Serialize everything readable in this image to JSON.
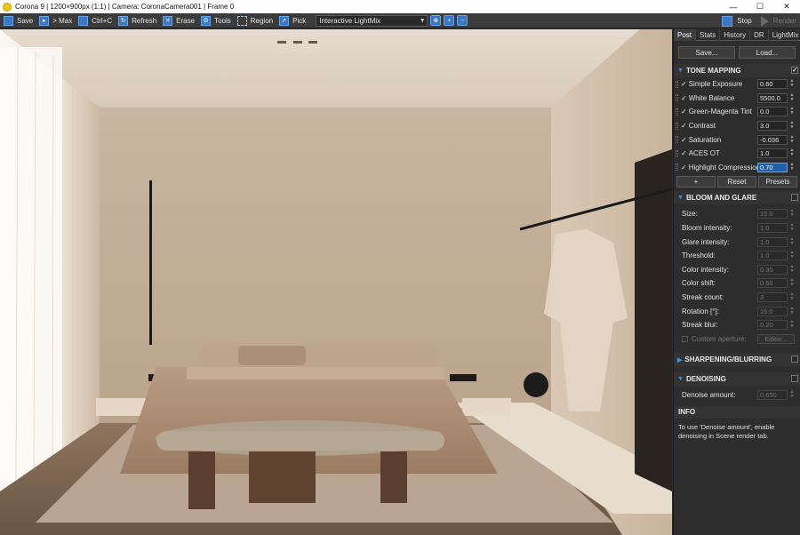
{
  "titlebar": {
    "title": "Corona 9 | 1200×900px (1:1) | Camera: CoronaCamera001 | Frame 0",
    "minimize": "—",
    "maximize": "☐",
    "close": "✕"
  },
  "toolbar": {
    "save": "Save",
    "max": "> Max",
    "copy": "Ctrl+C",
    "refresh": "Refresh",
    "erase": "Erase",
    "tools": "Tools",
    "region": "Region",
    "pick": "Pick",
    "mode": "Interactive LightMix",
    "stop": "Stop",
    "render": "Render"
  },
  "panel": {
    "tabs": [
      "Post",
      "Stats",
      "History",
      "DR",
      "LightMix"
    ],
    "save_btn": "Save...",
    "load_btn": "Load...",
    "tone_mapping": {
      "title": "TONE MAPPING",
      "enabled_mark": "✓",
      "rows": [
        {
          "label": "Simple Exposure",
          "value": "0.60"
        },
        {
          "label": "White Balance",
          "value": "5500.0"
        },
        {
          "label": "Green-Magenta Tint",
          "value": "0.0"
        },
        {
          "label": "Contrast",
          "value": "3.0"
        },
        {
          "label": "Saturation",
          "value": "-0.036"
        },
        {
          "label": "ACES OT",
          "value": "1.0"
        },
        {
          "label": "Highlight Compression",
          "value": "0.70"
        }
      ],
      "add_btn": "+",
      "reset_btn": "Reset",
      "presets_btn": "Presets"
    },
    "bloom": {
      "title": "BLOOM AND GLARE",
      "rows": [
        {
          "label": "Size:",
          "value": "15.0"
        },
        {
          "label": "Bloom intensity:",
          "value": "1.0"
        },
        {
          "label": "Glare intensity:",
          "value": "1.0"
        },
        {
          "label": "Threshold:",
          "value": "1.0"
        },
        {
          "label": "Color intensity:",
          "value": "0.30"
        },
        {
          "label": "Color shift:",
          "value": "0.50"
        },
        {
          "label": "Streak count:",
          "value": "3"
        },
        {
          "label": "Rotation [°]:",
          "value": "15.0"
        },
        {
          "label": "Streak blur:",
          "value": "0.20"
        }
      ],
      "custom_aperture": "Custom aperture:",
      "editor_btn": "Editor..."
    },
    "sharpening": {
      "title": "SHARPENING/BLURRING"
    },
    "denoising": {
      "title": "DENOISING",
      "label": "Denoise amount:",
      "value": "0.650"
    },
    "info": {
      "title": "INFO",
      "text": "To use 'Denoise amount', enable denoising in Scene render tab."
    }
  }
}
